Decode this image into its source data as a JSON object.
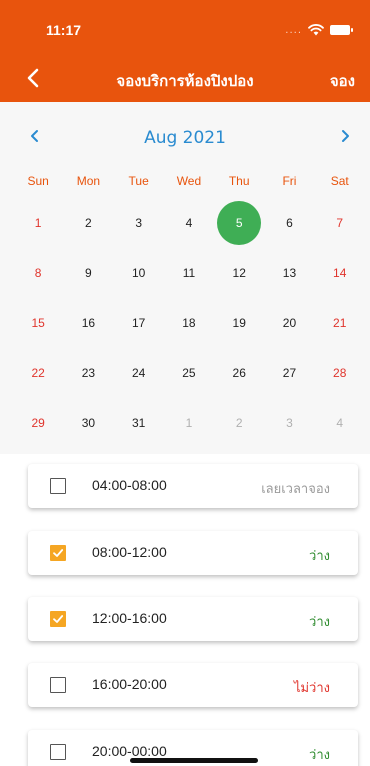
{
  "status_bar": {
    "time": "11:17",
    "signal_dots": "...."
  },
  "nav": {
    "title": "จองบริการห้องปิงปอง",
    "book_label": "จอง"
  },
  "calendar": {
    "month_title": "Aug 2021",
    "weekdays": [
      "Sun",
      "Mon",
      "Tue",
      "Wed",
      "Thu",
      "Fri",
      "Sat"
    ],
    "days": [
      {
        "d": "1",
        "type": "weekend"
      },
      {
        "d": "2",
        "type": "normal"
      },
      {
        "d": "3",
        "type": "normal"
      },
      {
        "d": "4",
        "type": "normal"
      },
      {
        "d": "5",
        "type": "selected"
      },
      {
        "d": "6",
        "type": "normal"
      },
      {
        "d": "7",
        "type": "weekend"
      },
      {
        "d": "8",
        "type": "weekend"
      },
      {
        "d": "9",
        "type": "normal"
      },
      {
        "d": "10",
        "type": "normal"
      },
      {
        "d": "11",
        "type": "normal"
      },
      {
        "d": "12",
        "type": "normal"
      },
      {
        "d": "13",
        "type": "normal"
      },
      {
        "d": "14",
        "type": "weekend"
      },
      {
        "d": "15",
        "type": "weekend"
      },
      {
        "d": "16",
        "type": "normal"
      },
      {
        "d": "17",
        "type": "normal"
      },
      {
        "d": "18",
        "type": "normal"
      },
      {
        "d": "19",
        "type": "normal"
      },
      {
        "d": "20",
        "type": "normal"
      },
      {
        "d": "21",
        "type": "weekend"
      },
      {
        "d": "22",
        "type": "weekend"
      },
      {
        "d": "23",
        "type": "normal"
      },
      {
        "d": "24",
        "type": "normal"
      },
      {
        "d": "25",
        "type": "normal"
      },
      {
        "d": "26",
        "type": "normal"
      },
      {
        "d": "27",
        "type": "normal"
      },
      {
        "d": "28",
        "type": "weekend"
      },
      {
        "d": "29",
        "type": "weekend"
      },
      {
        "d": "30",
        "type": "normal"
      },
      {
        "d": "31",
        "type": "normal"
      },
      {
        "d": "1",
        "type": "other"
      },
      {
        "d": "2",
        "type": "other"
      },
      {
        "d": "3",
        "type": "other"
      },
      {
        "d": "4",
        "type": "other"
      }
    ]
  },
  "slots": [
    {
      "time": "04:00-08:00",
      "status": "เลยเวลาจอง",
      "kind": "past",
      "checked": false
    },
    {
      "time": "08:00-12:00",
      "status": "ว่าง",
      "kind": "avail",
      "checked": true
    },
    {
      "time": "12:00-16:00",
      "status": "ว่าง",
      "kind": "avail",
      "checked": true
    },
    {
      "time": "16:00-20:00",
      "status": "ไม่ว่าง",
      "kind": "full",
      "checked": false
    },
    {
      "time": "20:00-00:00",
      "status": "ว่าง",
      "kind": "avail",
      "checked": false
    }
  ],
  "colors": {
    "header": "#e8540d",
    "month_title": "#2a8bd0",
    "selected_day": "#3fae55",
    "checkbox_checked": "#f5a623",
    "available": "#2e8b2e",
    "unavailable": "#e0342c"
  }
}
